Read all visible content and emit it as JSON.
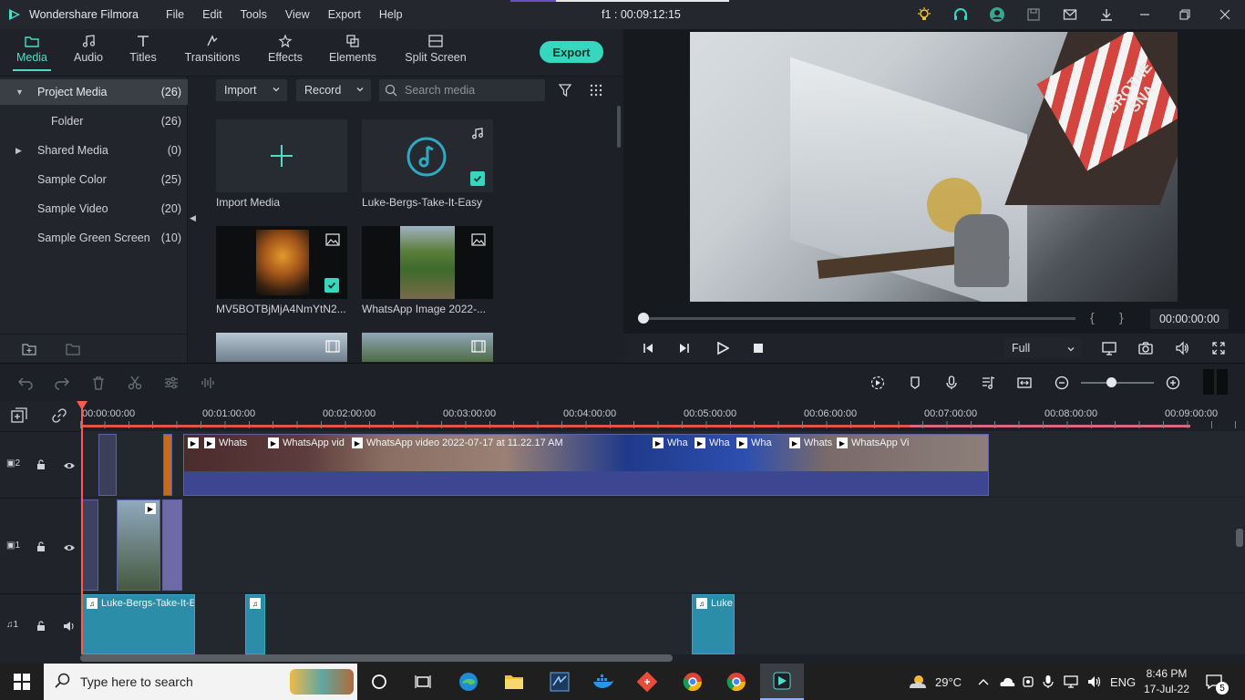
{
  "titlebar": {
    "app_name": "Wondershare Filmora",
    "menu": [
      "File",
      "Edit",
      "Tools",
      "View",
      "Export",
      "Help"
    ],
    "center_timecode": "f1 : 00:09:12:15"
  },
  "toolbar": {
    "tabs": [
      "Media",
      "Audio",
      "Titles",
      "Transitions",
      "Effects",
      "Elements",
      "Split Screen"
    ],
    "active_tab": "Media",
    "export_label": "Export"
  },
  "sidebar": {
    "items": [
      {
        "label": "Project Media",
        "count": "(26)"
      },
      {
        "label": "Folder",
        "count": "(26)"
      },
      {
        "label": "Shared Media",
        "count": "(0)"
      },
      {
        "label": "Sample Color",
        "count": "(25)"
      },
      {
        "label": "Sample Video",
        "count": "(20)"
      },
      {
        "label": "Sample Green Screen",
        "count": "(10)"
      }
    ]
  },
  "media": {
    "import_label": "Import",
    "record_label": "Record",
    "search_placeholder": "Search media",
    "items": [
      {
        "label": "Import Media"
      },
      {
        "label": "Luke-Bergs-Take-It-Easy"
      },
      {
        "label": "MV5BOTBjMjA4NmYtN2..."
      },
      {
        "label": "WhatsApp Image 2022-..."
      }
    ]
  },
  "preview": {
    "timecode": "00:00:00:00",
    "zoom": "Full",
    "brackets_in": "{",
    "brackets_out": "}",
    "sign_text": "BROTHE SNA"
  },
  "timeline": {
    "ruler": [
      "00:00:00:00",
      "00:01:00:00",
      "00:02:00:00",
      "00:03:00:00",
      "00:04:00:00",
      "00:05:00:00",
      "00:06:00:00",
      "00:07:00:00",
      "00:08:00:00",
      "00:09:00:00"
    ],
    "tracks": [
      {
        "label": "2",
        "kind": "video"
      },
      {
        "label": "1",
        "kind": "video"
      },
      {
        "label": "1",
        "kind": "audio"
      }
    ],
    "v2_clips": [
      "Whats",
      "WhatsApp vid",
      "WhatsApp video 2022-07-17 at 11.22.17 AM",
      "Wha",
      "Wha",
      "Wha",
      "Whats",
      "WhatsApp Vi"
    ],
    "audio_clips": [
      "Luke-Bergs-Take-It-E",
      "",
      "Luke"
    ]
  },
  "taskbar": {
    "search_placeholder": "Type here to search",
    "weather": "29°C",
    "lang": "ENG",
    "time": "8:46 PM",
    "date": "17-Jul-22",
    "notif_count": "5"
  },
  "colors": {
    "accent": "#35d8bf",
    "clip_video": "#2f3553",
    "clip_audio": "#2b8da8",
    "playhead": "#ff5a4e"
  }
}
